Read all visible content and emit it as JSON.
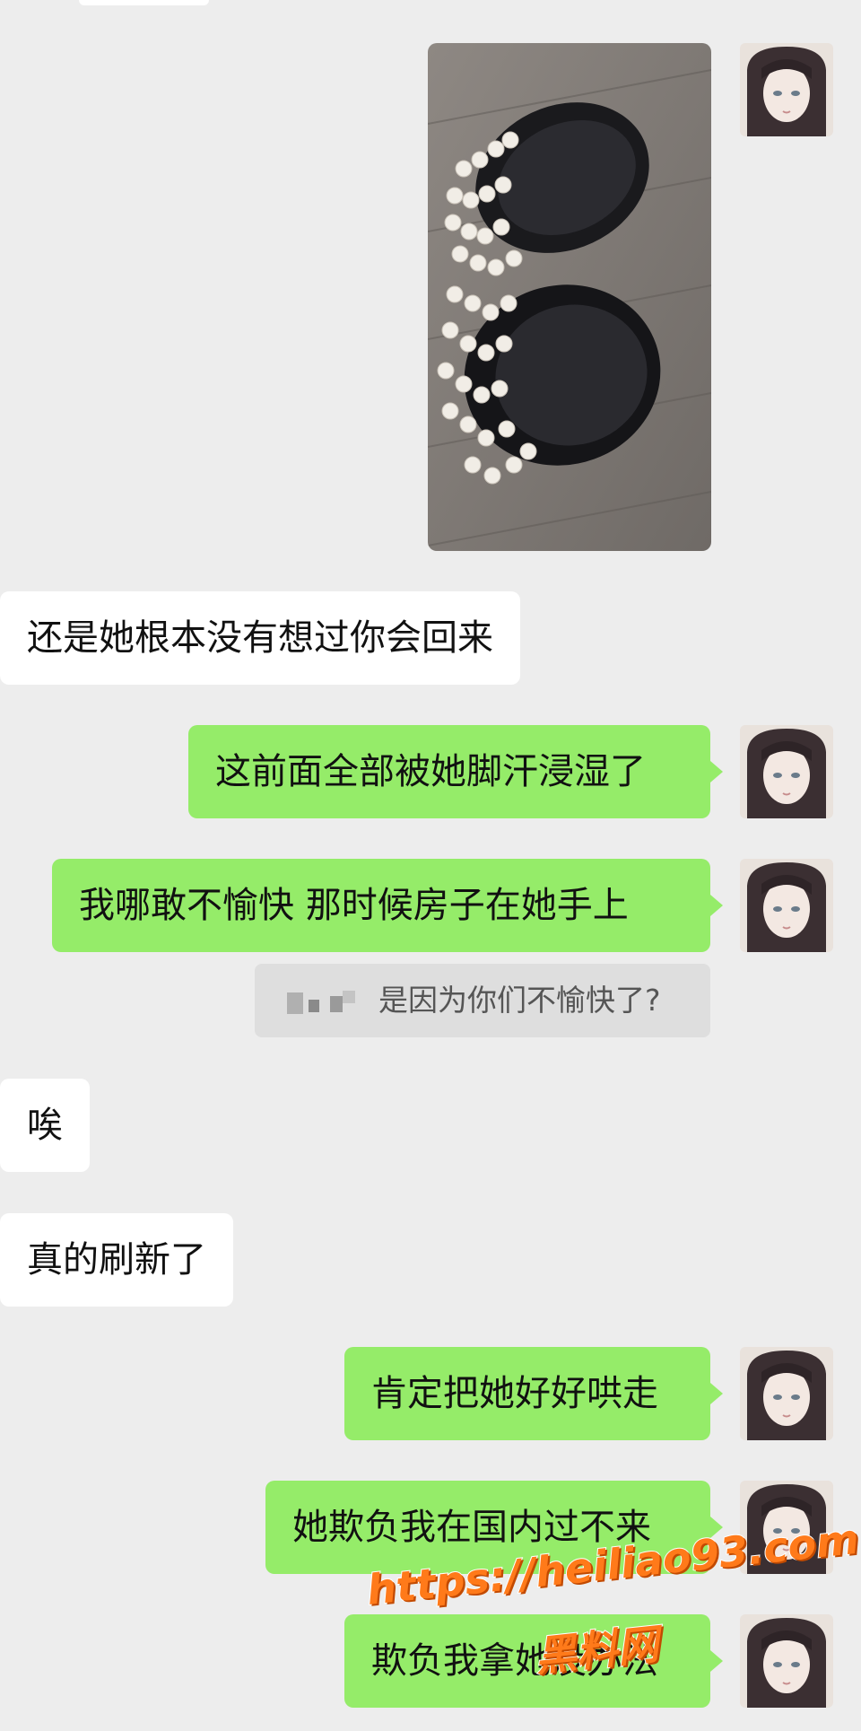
{
  "messages": [
    {
      "side": "in",
      "text": "还是她根本没有想过你会回来"
    },
    {
      "side": "out",
      "text": "这前面全部被她脚汗浸湿了"
    },
    {
      "side": "out",
      "text": "我哪敢不愉快 那时候房子在她手上"
    },
    {
      "side": "in",
      "text": "唉"
    },
    {
      "side": "in",
      "text": "真的刷新了"
    },
    {
      "side": "out",
      "text": "肯定把她好好哄走"
    },
    {
      "side": "out",
      "text": "她欺负我在国内过不来"
    },
    {
      "side": "out",
      "text": "欺负我拿她没办法"
    }
  ],
  "quote": {
    "text": "是因为你们不愉快了?"
  },
  "image_message": {
    "description_icon": "photo-of-pearl-slippers"
  },
  "avatar_icon": "anime-girl-avatar-icon",
  "watermark": {
    "url": "https://heiliao93.com",
    "name": "黑料网"
  },
  "colors": {
    "background": "#ededed",
    "outgoing": "#95ec69",
    "incoming": "#ffffff",
    "watermark": "#ff7a1a"
  }
}
